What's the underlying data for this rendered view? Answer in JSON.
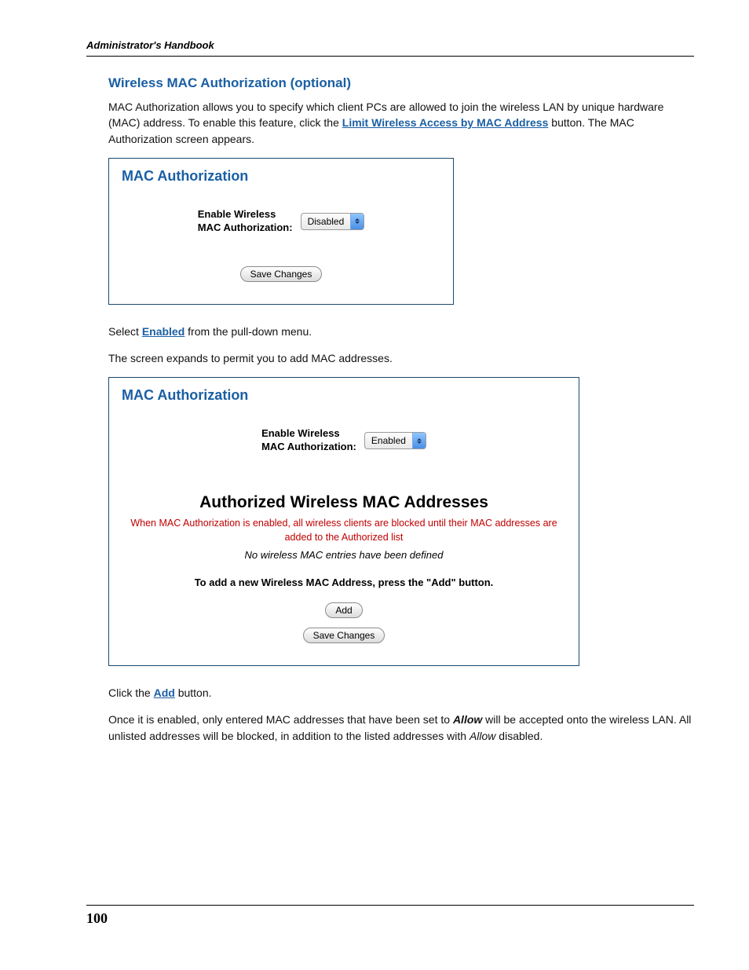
{
  "header": {
    "running": "Administrator's Handbook"
  },
  "section": {
    "title": "Wireless MAC Authorization (optional)",
    "intro_pre": "MAC Authorization allows you to specify which client PCs are allowed to join the wireless LAN by unique hardware (MAC) address. To enable this feature, click the ",
    "intro_link": "Limit Wireless Access by MAC Address",
    "intro_post": " button. The MAC Authorization screen appears."
  },
  "panel1": {
    "title": "MAC Authorization",
    "field_label": "Enable Wireless\nMAC Authorization:",
    "select_value": "Disabled",
    "save_label": "Save Changes"
  },
  "mid1": {
    "pre": "Select ",
    "link": "Enabled",
    "post": " from the pull-down menu."
  },
  "mid2": "The screen expands to permit you to add MAC addresses.",
  "panel2": {
    "title": "MAC Authorization",
    "field_label": "Enable Wireless\nMAC Authorization:",
    "select_value": "Enabled",
    "subhead": "Authorized Wireless MAC Addresses",
    "warn": "When MAC Authorization is enabled, all wireless clients are blocked until their MAC addresses are added to the Authorized list",
    "empty": "No wireless MAC entries have been defined",
    "instruct": "To add a new Wireless MAC Address, press the \"Add\" button.",
    "add_label": "Add",
    "save_label": "Save Changes"
  },
  "tail1": {
    "pre": "Click the ",
    "link": "Add",
    "post": " button."
  },
  "tail2": {
    "t1": "Once it is enabled, only entered MAC addresses that have been set to ",
    "allow1": "Allow",
    "t2": " will be accepted onto the wireless LAN. All unlisted addresses will be blocked, in addition to the listed addresses with ",
    "allow2": "Allow",
    "t3": " disabled."
  },
  "footer": {
    "page": "100"
  }
}
